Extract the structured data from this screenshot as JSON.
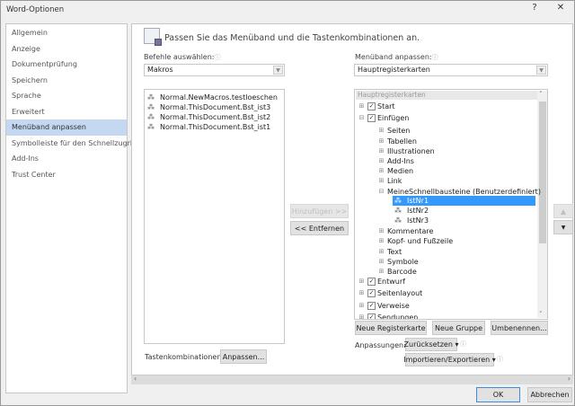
{
  "window": {
    "title": "Word-Optionen",
    "help": "?",
    "close": "✕"
  },
  "sidebar": {
    "items": [
      "Allgemein",
      "Anzeige",
      "Dokumentprüfung",
      "Speichern",
      "Sprache",
      "Erweitert",
      "Menüband anpassen",
      "Symbolleiste für den Schnellzugriff",
      "Add-Ins",
      "Trust Center"
    ],
    "selected": 6
  },
  "header": {
    "text": "Passen Sie das Menüband und die Tastenkombinationen an."
  },
  "left": {
    "label": "Befehle auswählen:",
    "select": "Makros",
    "items": [
      "Normal.NewMacros.testloeschen",
      "Normal.ThisDocument.Bst_ist3",
      "Normal.ThisDocument.Bst_ist2",
      "Normal.ThisDocument.Bst_ist1"
    ],
    "shortcuts_label": "Tastenkombinationen:",
    "customize_btn": "Anpassen..."
  },
  "middle": {
    "add_btn": "Hinzufügen >>",
    "remove_btn": "<< Entfernen"
  },
  "right": {
    "label": "Menüband anpassen:",
    "select": "Hauptregisterkarten",
    "tree_header": "Hauptregisterkarten",
    "tree": [
      {
        "label": "Start",
        "level": 0,
        "pm": "⊞",
        "check": true
      },
      {
        "label": "Einfügen",
        "level": 0,
        "pm": "⊟",
        "check": true
      },
      {
        "label": "Seiten",
        "level": 1,
        "pm": "⊞"
      },
      {
        "label": "Tabellen",
        "level": 1,
        "pm": "⊞"
      },
      {
        "label": "Illustrationen",
        "level": 1,
        "pm": "⊞"
      },
      {
        "label": "Add-Ins",
        "level": 1,
        "pm": "⊞"
      },
      {
        "label": "Medien",
        "level": 1,
        "pm": "⊞"
      },
      {
        "label": "Link",
        "level": 1,
        "pm": "⊞"
      },
      {
        "label": "MeineSchnellbausteine (Benutzerdefiniert)",
        "level": 1,
        "pm": "⊟"
      },
      {
        "label": "IstNr1",
        "level": 2,
        "macro": true,
        "selected": true
      },
      {
        "label": "IstNr2",
        "level": 2,
        "macro": true
      },
      {
        "label": "IstNr3",
        "level": 2,
        "macro": true
      },
      {
        "label": "Kommentare",
        "level": 1,
        "pm": "⊞"
      },
      {
        "label": "Kopf- und Fußzeile",
        "level": 1,
        "pm": "⊞"
      },
      {
        "label": "Text",
        "level": 1,
        "pm": "⊞"
      },
      {
        "label": "Symbole",
        "level": 1,
        "pm": "⊞"
      },
      {
        "label": "Barcode",
        "level": 1,
        "pm": "⊞"
      },
      {
        "label": "Entwurf",
        "level": 0,
        "pm": "⊞",
        "check": true
      },
      {
        "label": "Seitenlayout",
        "level": 0,
        "pm": "⊞",
        "check": true
      },
      {
        "label": "Verweise",
        "level": 0,
        "pm": "⊞",
        "check": true
      },
      {
        "label": "Sendungen",
        "level": 0,
        "pm": "⊞",
        "check": true
      }
    ],
    "new_tab_btn": "Neue Registerkarte",
    "new_group_btn": "Neue Gruppe",
    "rename_btn": "Umbenennen...",
    "customizations_label": "Anpassungen:",
    "reset_btn": "Zurücksetzen ▾",
    "import_export_btn": "Importieren/Exportieren ▾"
  },
  "footer": {
    "ok": "OK",
    "cancel": "Abbrechen"
  },
  "colors": {
    "selection": "#3399ff",
    "sidebar_selected": "#c5d8f2"
  }
}
